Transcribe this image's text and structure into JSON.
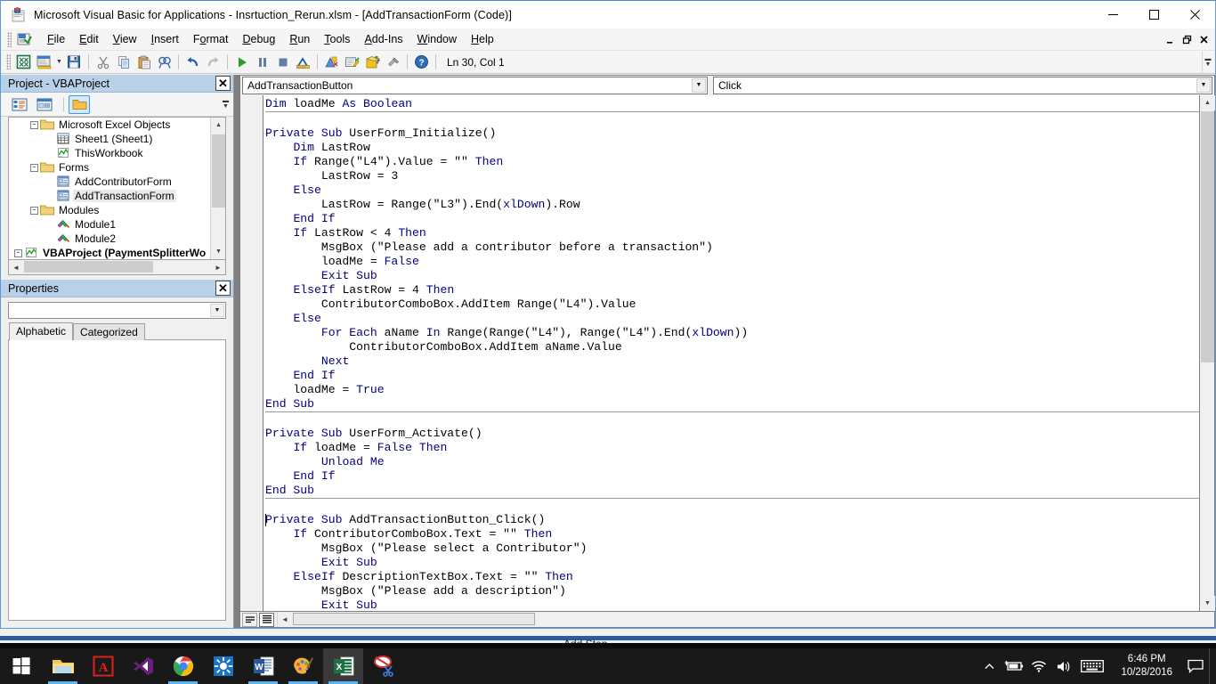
{
  "window": {
    "title": "Microsoft Visual Basic for Applications - Insrtuction_Rerun.xlsm - [AddTransactionForm (Code)]",
    "app_icon": "vba-icon",
    "minimize": "—",
    "maximize": "☐",
    "close": "✕"
  },
  "mdi_controls": {
    "minimize": "_",
    "restore": "❐",
    "close": "✕"
  },
  "menu": {
    "items": [
      {
        "label": "File",
        "accel": "F"
      },
      {
        "label": "Edit",
        "accel": "E"
      },
      {
        "label": "View",
        "accel": "V"
      },
      {
        "label": "Insert",
        "accel": "I"
      },
      {
        "label": "Format",
        "accel": "o"
      },
      {
        "label": "Debug",
        "accel": "D"
      },
      {
        "label": "Run",
        "accel": "R"
      },
      {
        "label": "Tools",
        "accel": "T"
      },
      {
        "label": "Add-Ins",
        "accel": "A"
      },
      {
        "label": "Window",
        "accel": "W"
      },
      {
        "label": "Help",
        "accel": "H"
      }
    ]
  },
  "toolbar": {
    "buttons": [
      {
        "name": "view-excel-icon",
        "title": "View Microsoft Excel"
      },
      {
        "name": "insert-userform-icon",
        "title": "Insert UserForm"
      },
      {
        "name": "save-icon",
        "title": "Save"
      },
      {
        "name": "cut-icon",
        "title": "Cut"
      },
      {
        "name": "copy-icon",
        "title": "Copy"
      },
      {
        "name": "paste-icon",
        "title": "Paste"
      },
      {
        "name": "find-icon",
        "title": "Find"
      },
      {
        "name": "undo-icon",
        "title": "Undo"
      },
      {
        "name": "redo-icon",
        "title": "Redo"
      },
      {
        "name": "run-icon",
        "title": "Run Sub/UserForm"
      },
      {
        "name": "break-icon",
        "title": "Break"
      },
      {
        "name": "reset-icon",
        "title": "Reset"
      },
      {
        "name": "design-mode-icon",
        "title": "Design Mode"
      },
      {
        "name": "project-explorer-icon",
        "title": "Project Explorer"
      },
      {
        "name": "properties-window-icon",
        "title": "Properties Window"
      },
      {
        "name": "object-browser-icon",
        "title": "Object Browser"
      },
      {
        "name": "toolbox-icon",
        "title": "Toolbox"
      },
      {
        "name": "help-icon",
        "title": "Help"
      }
    ],
    "status": "Ln 30, Col 1"
  },
  "project_panel": {
    "title": "Project - VBAProject",
    "close_label": "✕",
    "toolbar": [
      {
        "name": "view-code-icon",
        "title": "View Code"
      },
      {
        "name": "view-object-icon",
        "title": "View Object"
      },
      {
        "name": "toggle-folders-icon",
        "title": "Toggle Folders",
        "active": true
      }
    ],
    "tree": [
      {
        "label": "Microsoft Excel Objects",
        "icon": "folder-icon",
        "indent": 1,
        "expander": "-",
        "selected": false,
        "bold": false
      },
      {
        "label": "Sheet1 (Sheet1)",
        "icon": "worksheet-icon",
        "indent": 2,
        "expander": "",
        "selected": false,
        "bold": false
      },
      {
        "label": "ThisWorkbook",
        "icon": "workbook-icon",
        "indent": 2,
        "expander": "",
        "selected": false,
        "bold": false
      },
      {
        "label": "Forms",
        "icon": "folder-icon",
        "indent": 1,
        "expander": "-",
        "selected": false,
        "bold": false
      },
      {
        "label": "AddContributorForm",
        "icon": "userform-icon",
        "indent": 2,
        "expander": "",
        "selected": false,
        "bold": false
      },
      {
        "label": "AddTransactionForm",
        "icon": "userform-icon",
        "indent": 2,
        "expander": "",
        "selected": true,
        "bold": false
      },
      {
        "label": "Modules",
        "icon": "folder-icon",
        "indent": 1,
        "expander": "-",
        "selected": false,
        "bold": false
      },
      {
        "label": "Module1",
        "icon": "module-icon",
        "indent": 2,
        "expander": "",
        "selected": false,
        "bold": false
      },
      {
        "label": "Module2",
        "icon": "module-icon",
        "indent": 2,
        "expander": "",
        "selected": false,
        "bold": false
      },
      {
        "label": "VBAProject (PaymentSplitterWo",
        "icon": "project-icon",
        "indent": 0,
        "expander": "-",
        "selected": false,
        "bold": true
      }
    ]
  },
  "properties_panel": {
    "title": "Properties",
    "close_label": "✕",
    "selected_object": "",
    "tabs": [
      {
        "label": "Alphabetic",
        "active": true
      },
      {
        "label": "Categorized",
        "active": false
      }
    ]
  },
  "code_window": {
    "object_dropdown": "AddTransactionButton",
    "procedure_dropdown": "Click",
    "view_buttons": [
      {
        "name": "procedure-view-icon",
        "title": "Procedure View",
        "active": false
      },
      {
        "name": "full-module-view-icon",
        "title": "Full Module View",
        "active": true
      }
    ],
    "lines": [
      {
        "sep": false,
        "tokens": [
          {
            "t": "Dim",
            "k": true
          },
          {
            "t": " loadMe ",
            "k": false
          },
          {
            "t": "As Boolean",
            "k": true
          }
        ]
      },
      {
        "sep": true,
        "tokens": []
      },
      {
        "sep": false,
        "tokens": []
      },
      {
        "sep": false,
        "tokens": [
          {
            "t": "Private Sub ",
            "k": true
          },
          {
            "t": "UserForm_Initialize()",
            "k": false
          }
        ]
      },
      {
        "sep": false,
        "tokens": [
          {
            "t": "    ",
            "k": false
          },
          {
            "t": "Dim",
            "k": true
          },
          {
            "t": " LastRow",
            "k": false
          }
        ]
      },
      {
        "sep": false,
        "tokens": [
          {
            "t": "    ",
            "k": false
          },
          {
            "t": "If",
            "k": true
          },
          {
            "t": " Range(\"L4\").Value = \"\" ",
            "k": false
          },
          {
            "t": "Then",
            "k": true
          }
        ]
      },
      {
        "sep": false,
        "tokens": [
          {
            "t": "        LastRow = 3",
            "k": false
          }
        ]
      },
      {
        "sep": false,
        "tokens": [
          {
            "t": "    ",
            "k": false
          },
          {
            "t": "Else",
            "k": true
          }
        ]
      },
      {
        "sep": false,
        "tokens": [
          {
            "t": "        LastRow = Range(\"L3\").End(",
            "k": false
          },
          {
            "t": "xlDown",
            "k": true
          },
          {
            "t": ").Row",
            "k": false
          }
        ]
      },
      {
        "sep": false,
        "tokens": [
          {
            "t": "    ",
            "k": false
          },
          {
            "t": "End If",
            "k": true
          }
        ]
      },
      {
        "sep": false,
        "tokens": [
          {
            "t": "    ",
            "k": false
          },
          {
            "t": "If",
            "k": true
          },
          {
            "t": " LastRow < 4 ",
            "k": false
          },
          {
            "t": "Then",
            "k": true
          }
        ]
      },
      {
        "sep": false,
        "tokens": [
          {
            "t": "        MsgBox (\"Please add a contributor before a transaction\")",
            "k": false
          }
        ]
      },
      {
        "sep": false,
        "tokens": [
          {
            "t": "        loadMe = ",
            "k": false
          },
          {
            "t": "False",
            "k": true
          }
        ]
      },
      {
        "sep": false,
        "tokens": [
          {
            "t": "        ",
            "k": false
          },
          {
            "t": "Exit Sub",
            "k": true
          }
        ]
      },
      {
        "sep": false,
        "tokens": [
          {
            "t": "    ",
            "k": false
          },
          {
            "t": "ElseIf",
            "k": true
          },
          {
            "t": " LastRow = 4 ",
            "k": false
          },
          {
            "t": "Then",
            "k": true
          }
        ]
      },
      {
        "sep": false,
        "tokens": [
          {
            "t": "        ContributorComboBox.AddItem Range(\"L4\").Value",
            "k": false
          }
        ]
      },
      {
        "sep": false,
        "tokens": [
          {
            "t": "    ",
            "k": false
          },
          {
            "t": "Else",
            "k": true
          }
        ]
      },
      {
        "sep": false,
        "tokens": [
          {
            "t": "        ",
            "k": false
          },
          {
            "t": "For Each",
            "k": true
          },
          {
            "t": " aName ",
            "k": false
          },
          {
            "t": "In",
            "k": true
          },
          {
            "t": " Range(Range(\"L4\"), Range(\"L4\").End(",
            "k": false
          },
          {
            "t": "xlDown",
            "k": true
          },
          {
            "t": "))",
            "k": false
          }
        ]
      },
      {
        "sep": false,
        "tokens": [
          {
            "t": "            ContributorComboBox.AddItem aName.Value",
            "k": false
          }
        ]
      },
      {
        "sep": false,
        "tokens": [
          {
            "t": "        ",
            "k": false
          },
          {
            "t": "Next",
            "k": true
          }
        ]
      },
      {
        "sep": false,
        "tokens": [
          {
            "t": "    ",
            "k": false
          },
          {
            "t": "End If",
            "k": true
          }
        ]
      },
      {
        "sep": false,
        "tokens": [
          {
            "t": "    loadMe = ",
            "k": false
          },
          {
            "t": "True",
            "k": true
          }
        ]
      },
      {
        "sep": false,
        "tokens": [
          {
            "t": "End Sub",
            "k": true
          }
        ]
      },
      {
        "sep": true,
        "tokens": []
      },
      {
        "sep": false,
        "tokens": []
      },
      {
        "sep": false,
        "tokens": [
          {
            "t": "Private Sub ",
            "k": true
          },
          {
            "t": "UserForm_Activate()",
            "k": false
          }
        ]
      },
      {
        "sep": false,
        "tokens": [
          {
            "t": "    ",
            "k": false
          },
          {
            "t": "If",
            "k": true
          },
          {
            "t": " loadMe = ",
            "k": false
          },
          {
            "t": "False Then",
            "k": true
          }
        ]
      },
      {
        "sep": false,
        "tokens": [
          {
            "t": "        ",
            "k": false
          },
          {
            "t": "Unload Me",
            "k": true
          }
        ]
      },
      {
        "sep": false,
        "tokens": [
          {
            "t": "    ",
            "k": false
          },
          {
            "t": "End If",
            "k": true
          }
        ]
      },
      {
        "sep": false,
        "tokens": [
          {
            "t": "End Sub",
            "k": true
          }
        ]
      },
      {
        "sep": true,
        "tokens": []
      },
      {
        "sep": false,
        "tokens": []
      },
      {
        "sep": false,
        "tokens": [
          {
            "t": "Private Sub ",
            "k": true
          },
          {
            "t": "AddTransactionButton_Click()",
            "k": false
          }
        ]
      },
      {
        "sep": false,
        "tokens": [
          {
            "t": "    ",
            "k": false
          },
          {
            "t": "If",
            "k": true
          },
          {
            "t": " ContributorComboBox.Text = \"\" ",
            "k": false
          },
          {
            "t": "Then",
            "k": true
          }
        ]
      },
      {
        "sep": false,
        "tokens": [
          {
            "t": "        MsgBox (\"Please select a Contributor\")",
            "k": false
          }
        ]
      },
      {
        "sep": false,
        "tokens": [
          {
            "t": "        ",
            "k": false
          },
          {
            "t": "Exit Sub",
            "k": true
          }
        ]
      },
      {
        "sep": false,
        "tokens": [
          {
            "t": "    ",
            "k": false
          },
          {
            "t": "ElseIf",
            "k": true
          },
          {
            "t": " DescriptionTextBox.Text = \"\" ",
            "k": false
          },
          {
            "t": "Then",
            "k": true
          }
        ]
      },
      {
        "sep": false,
        "tokens": [
          {
            "t": "        MsgBox (\"Please add a description\")",
            "k": false
          }
        ]
      },
      {
        "sep": false,
        "tokens": [
          {
            "t": "        ",
            "k": false
          },
          {
            "t": "Exit Sub",
            "k": true
          }
        ]
      }
    ]
  },
  "background_window": {
    "label": "Add Step"
  },
  "taskbar": {
    "start": {
      "name": "start-button",
      "label": "Windows"
    },
    "apps": [
      {
        "name": "file-explorer-icon",
        "label": "File Explorer",
        "active": false,
        "running": true
      },
      {
        "name": "adobe-acrobat-icon",
        "label": "Adobe Acrobat",
        "active": false,
        "running": false
      },
      {
        "name": "visual-studio-icon",
        "label": "Visual Studio",
        "active": false,
        "running": false
      },
      {
        "name": "google-chrome-icon",
        "label": "Google Chrome",
        "active": false,
        "running": true
      },
      {
        "name": "settings-app-icon",
        "label": "Settings",
        "active": false,
        "running": false
      },
      {
        "name": "microsoft-word-icon",
        "label": "Microsoft Word",
        "active": false,
        "running": true
      },
      {
        "name": "paint-icon",
        "label": "Paint",
        "active": false,
        "running": true
      },
      {
        "name": "microsoft-excel-icon",
        "label": "Microsoft Excel",
        "active": true,
        "running": true
      },
      {
        "name": "snipping-tool-icon",
        "label": "Snipping Tool",
        "active": false,
        "running": false
      }
    ],
    "tray": {
      "show_hidden": "show-hidden-icons",
      "battery": "battery-charging-icon",
      "network": "wifi-icon",
      "volume": "speaker-icon",
      "keyboard": "touch-keyboard-icon",
      "time": "6:46 PM",
      "date": "10/28/2016",
      "notifications": "action-center-icon"
    }
  },
  "colors": {
    "title_bar": "#ffffff",
    "panel_title": "#b9d1e8",
    "accent": "#5b9bd5",
    "keyword": "#00007f",
    "code_bg": "#ffffff",
    "taskbar": "#191919",
    "mdi_bg": "#7f7f7f"
  }
}
